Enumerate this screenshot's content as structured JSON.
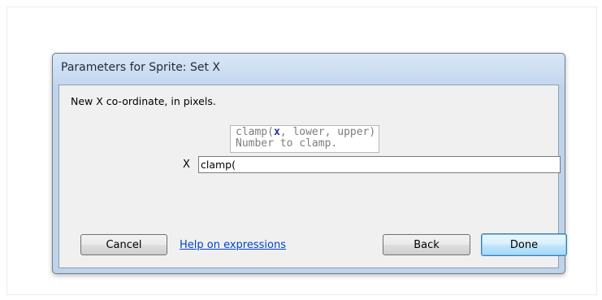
{
  "dialog": {
    "title": "Parameters for Sprite: Set X",
    "description": "New X co-ordinate, in pixels."
  },
  "tooltip": {
    "signature_prefix": "clamp(",
    "signature_highlight": "x",
    "signature_suffix": ", lower, upper)",
    "hint": "Number to clamp."
  },
  "field": {
    "label": "X",
    "value": "clamp("
  },
  "buttons": {
    "cancel": "Cancel",
    "help": "Help on expressions",
    "back": "Back",
    "done": "Done"
  }
}
